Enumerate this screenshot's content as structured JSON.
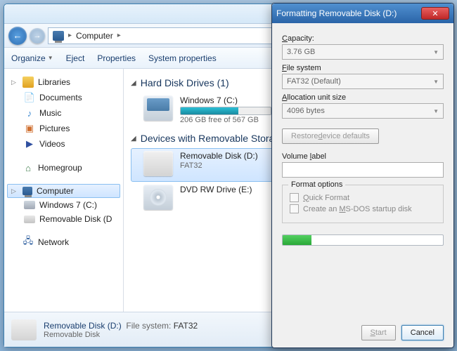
{
  "address": {
    "location": "Computer"
  },
  "toolbar": {
    "organize": "Organize",
    "eject": "Eject",
    "properties": "Properties",
    "system_properties": "System properties"
  },
  "sidebar": {
    "libraries": "Libraries",
    "documents": "Documents",
    "music": "Music",
    "pictures": "Pictures",
    "videos": "Videos",
    "homegroup": "Homegroup",
    "computer": "Computer",
    "windows7": "Windows 7 (C:)",
    "removable_short": "Removable Disk (D",
    "network": "Network"
  },
  "content": {
    "hdd_header": "Hard Disk Drives (1)",
    "hdd_name": "Windows 7 (C:)",
    "hdd_free": "206 GB free of 567 GB",
    "hdd_fill_pct": 64,
    "removable_header": "Devices with Removable Storage",
    "usb_name": "Removable Disk (D:)",
    "usb_fs": "FAT32",
    "dvd_name": "DVD RW Drive (E:)"
  },
  "status": {
    "name": "Removable Disk (D:)",
    "sub": "Removable Disk",
    "fs_label": "File system:",
    "fs_value": "FAT32"
  },
  "dialog": {
    "title": "Formatting Removable Disk (D:)",
    "capacity_label": "Capacity:",
    "capacity_value": "3.76 GB",
    "filesystem_label": "File system",
    "filesystem_value": "FAT32 (Default)",
    "allocation_label": "Allocation unit size",
    "allocation_value": "4096 bytes",
    "restore_defaults": "Restore device defaults",
    "volume_label": "Volume label",
    "volume_value": "",
    "format_options": "Format options",
    "quick_format": "Quick Format",
    "msdos_startup": "Create an MS-DOS startup disk",
    "progress_pct": 18,
    "start": "Start",
    "cancel": "Cancel"
  }
}
